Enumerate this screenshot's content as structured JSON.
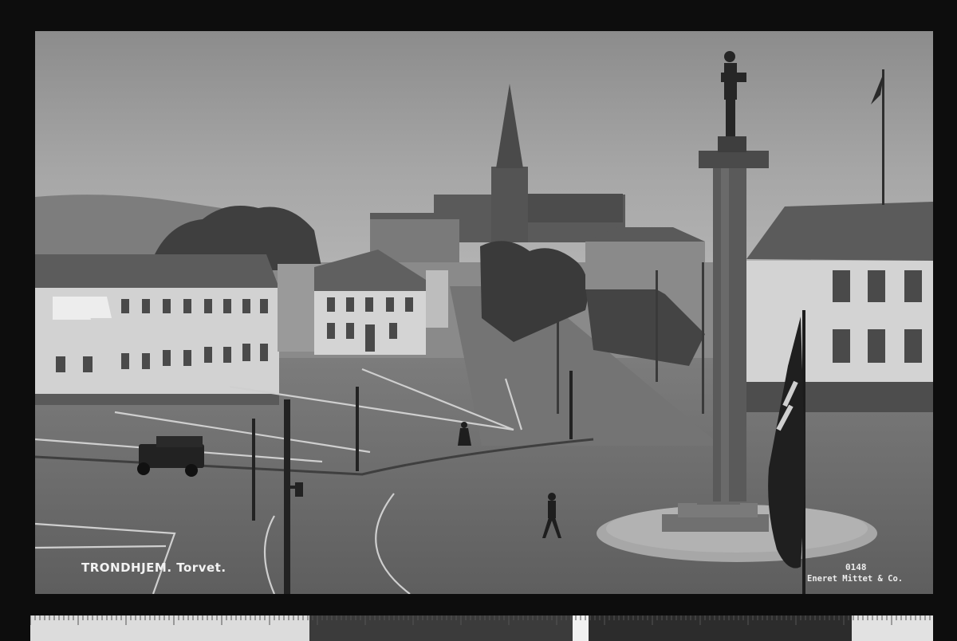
{
  "postcard": {
    "caption": "TRONDHJEM. Torvet.",
    "plate_number": "0148",
    "publisher": "Eneret Mittet & Co."
  },
  "colors": {
    "border": "#0d0d0d",
    "sky": "#9a9a9a",
    "pavement": "#6f6f6f",
    "building_light": "#cfcfcf",
    "roof_dark": "#4a4a4a",
    "ruler_light": "#d9d9d9",
    "ruler_dark": "#3a3a3a"
  },
  "icons": [
    "scale-ruler-icon"
  ]
}
